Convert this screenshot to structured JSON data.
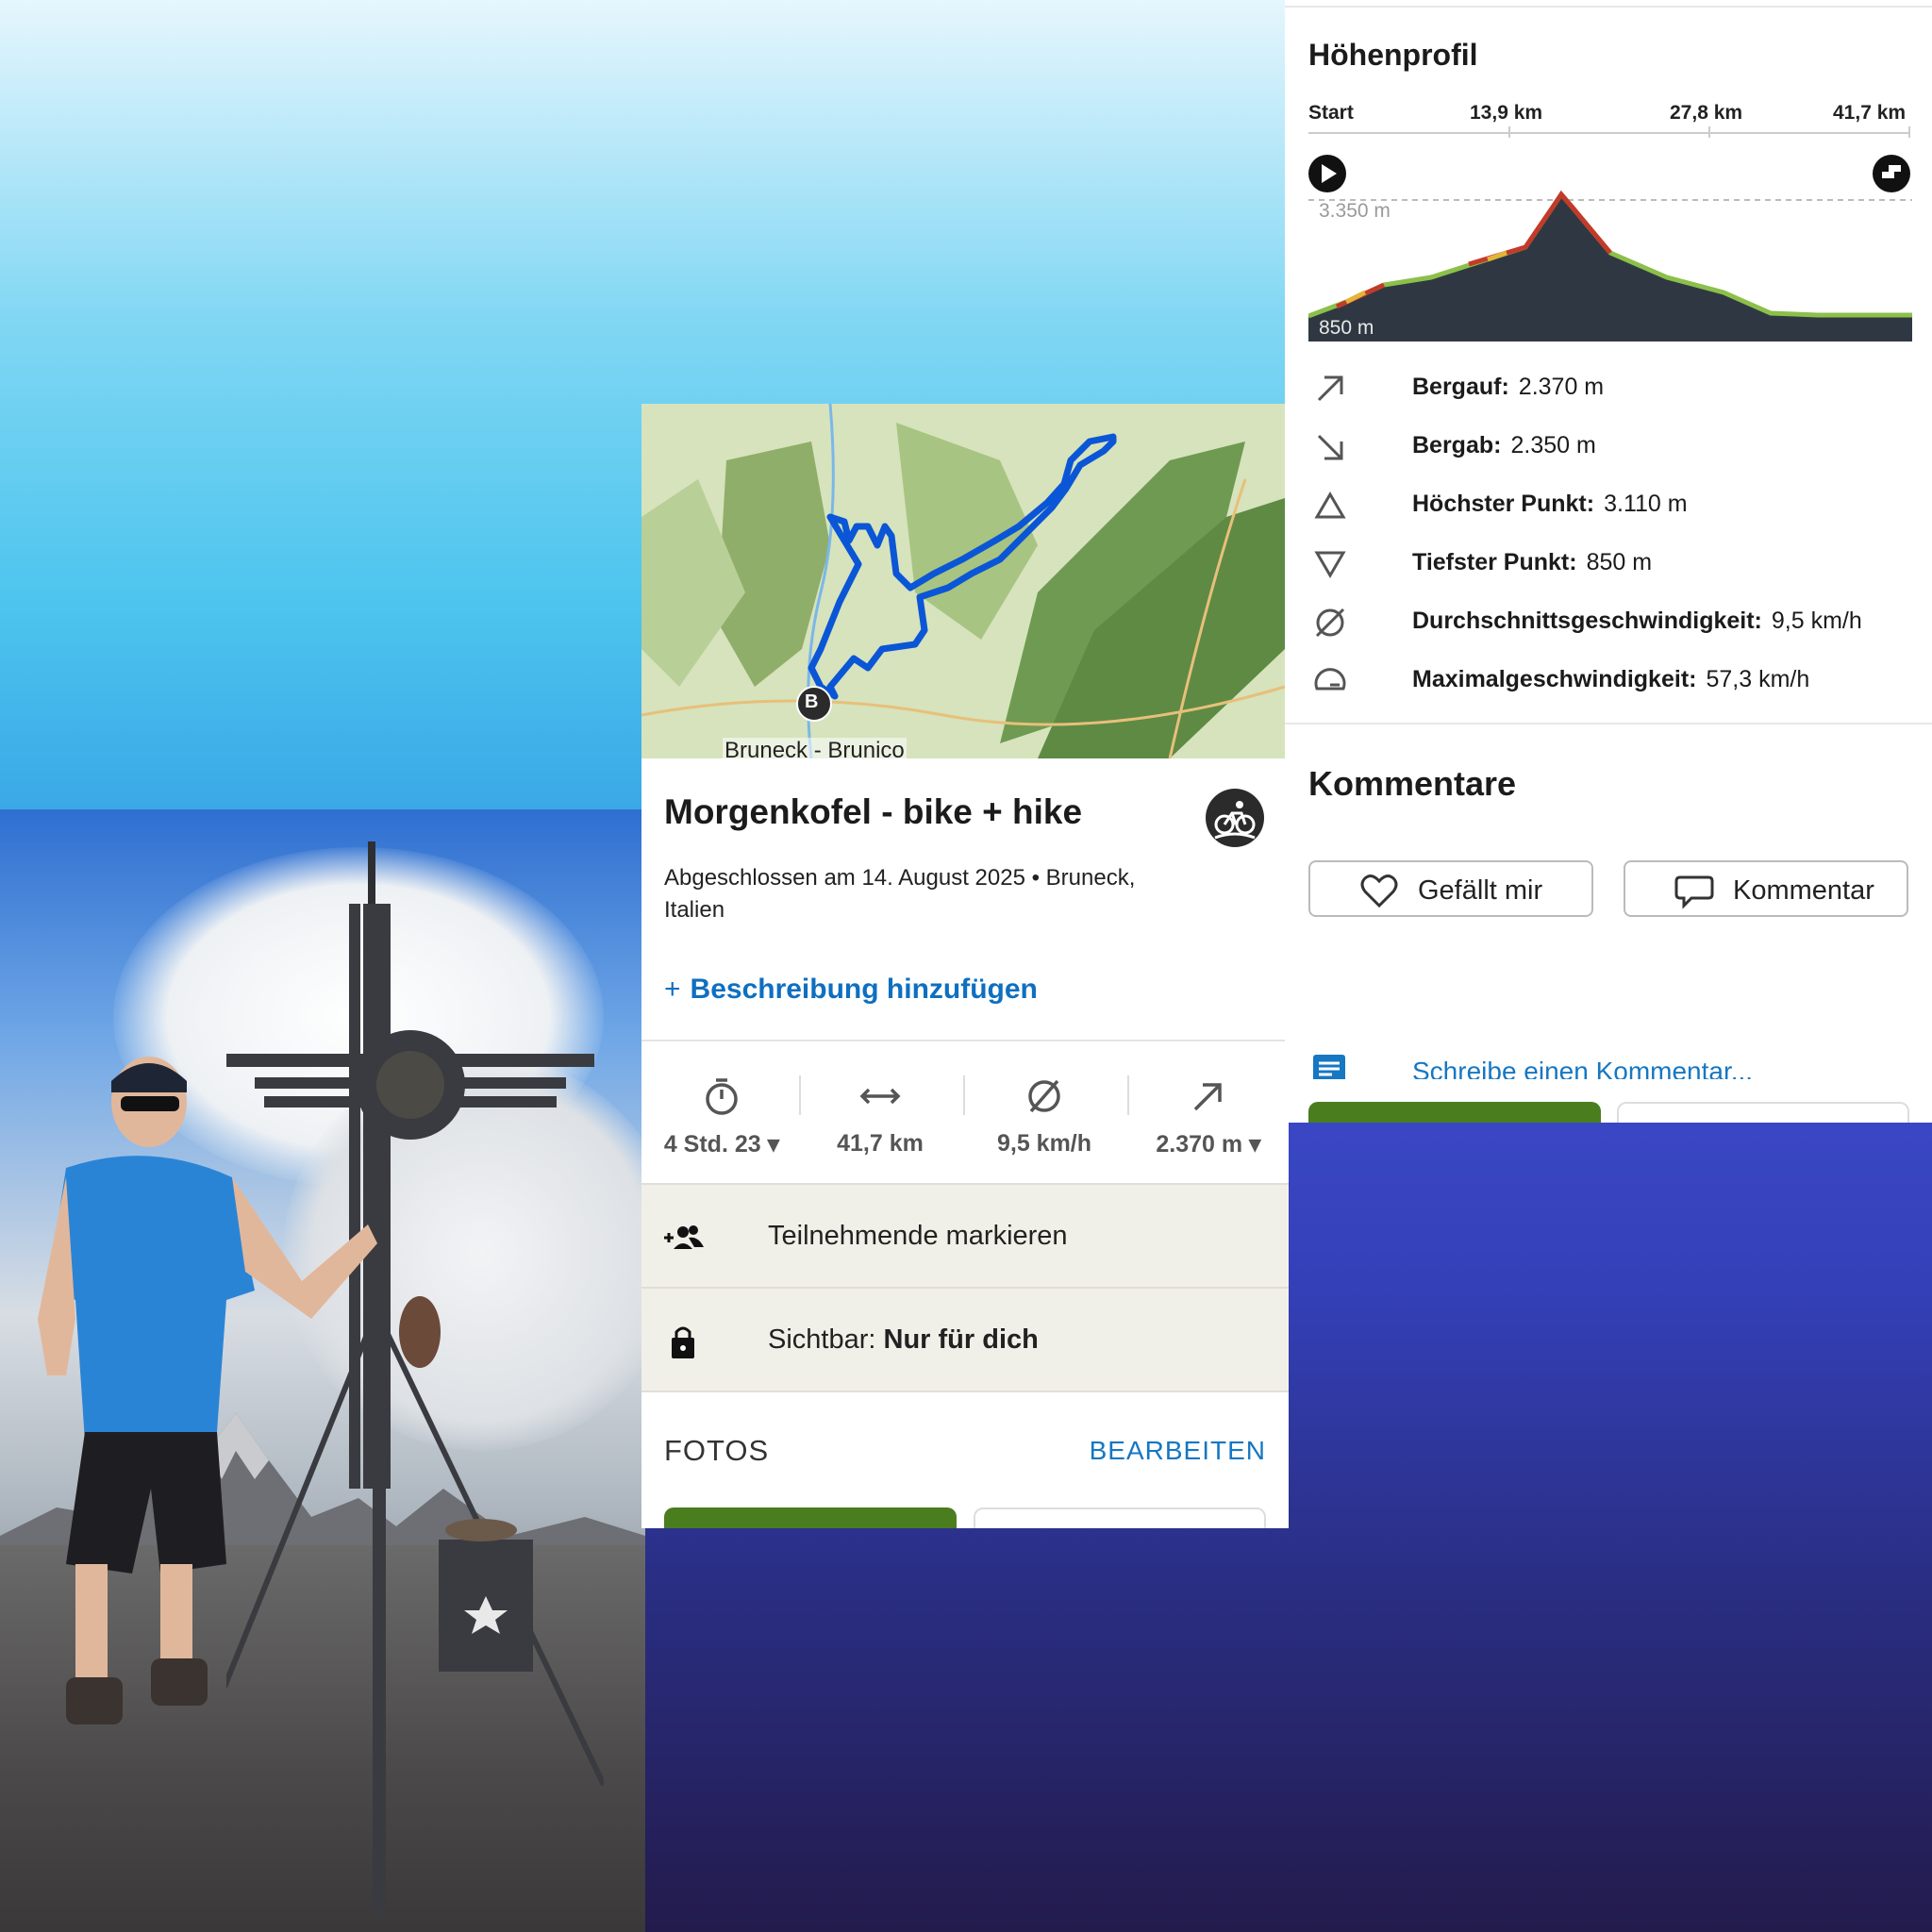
{
  "map": {
    "place_label": "Bruneck - Brunico",
    "marker_label": "B"
  },
  "tour": {
    "title": "Morgenkofel - bike + hike",
    "subtitle": "Abgeschlossen am 14. August 2025 • Bruneck, Italien",
    "add_description": "Beschreibung hinzufügen",
    "sport_icon": "mountain-bike-icon"
  },
  "stats": [
    {
      "icon": "stopwatch-icon",
      "value": "4 Std. 23 ▾"
    },
    {
      "icon": "distance-icon",
      "value": "41,7 km"
    },
    {
      "icon": "average-speed-icon",
      "value": "9,5 km/h"
    },
    {
      "icon": "uphill-icon",
      "value": "2.370 m ▾"
    }
  ],
  "participants": {
    "label": "Teilnehmende markieren"
  },
  "visibility": {
    "label": "Sichtbar:",
    "value": "Nur für dich"
  },
  "photos": {
    "heading": "FOTOS",
    "edit": "BEARBEITEN"
  },
  "elevation": {
    "title": "Höhenprofil",
    "axis": [
      "Start",
      "13,9 km",
      "27,8 km",
      "41,7 km"
    ],
    "max_label": "3.350 m",
    "min_label": "850 m"
  },
  "details": [
    {
      "icon": "uphill-arrow-icon",
      "label": "Bergauf:",
      "value": "2.370 m"
    },
    {
      "icon": "downhill-arrow-icon",
      "label": "Bergab:",
      "value": "2.350 m"
    },
    {
      "icon": "highest-point-icon",
      "label": "Höchster Punkt:",
      "value": "3.110 m"
    },
    {
      "icon": "lowest-point-icon",
      "label": "Tiefster Punkt:",
      "value": "850 m"
    },
    {
      "icon": "average-speed-icon",
      "label": "Durchschnittsgeschwindigkeit:",
      "value": "9,5 km/h"
    },
    {
      "icon": "max-speed-icon",
      "label": "Maximalgeschwindigkeit:",
      "value": "57,3 km/h"
    }
  ],
  "comments": {
    "title": "Kommentare",
    "like": "Gefällt mir",
    "comment": "Kommentar",
    "write_placeholder": "Schreibe einen Kommentar..."
  },
  "colors": {
    "accent_blue": "#1677c2",
    "button_green": "#4a7d1e",
    "row_bg": "#f1f0e8"
  }
}
